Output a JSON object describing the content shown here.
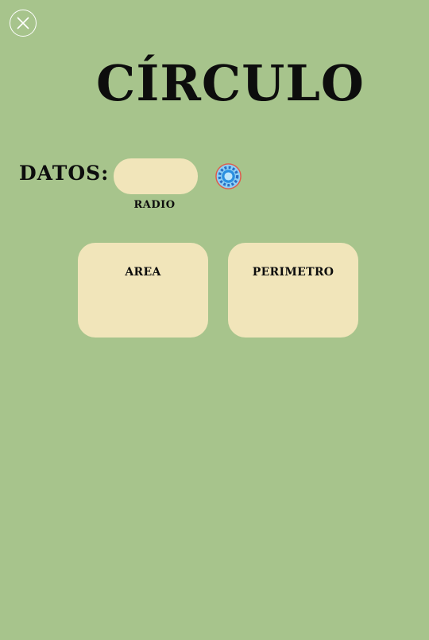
{
  "header": {
    "close_icon": "close-icon",
    "title": "CÍRCULO"
  },
  "inputs": {
    "section_label": "DATOS:",
    "radio": {
      "value": "",
      "placeholder": "",
      "caption": "RADIO"
    },
    "calculate_icon": "gear-refresh-icon"
  },
  "results": {
    "area": {
      "label": "AREA",
      "value": ""
    },
    "perimetro": {
      "label": "PERIMETRO",
      "value": ""
    }
  },
  "colors": {
    "background": "#a7c48c",
    "field": "#f1e5ba",
    "text": "#0d0d0d",
    "icon_blue": "#2a8fe0",
    "icon_ring": "#e05a4a"
  }
}
